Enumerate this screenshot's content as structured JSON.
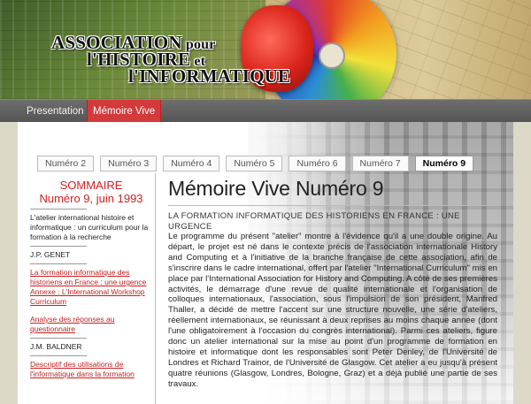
{
  "banner": {
    "line1": "ASSOCIATION",
    "line1_small": " pour",
    "line2": "l'HISTOIRE",
    "line2_small": " et",
    "line3": "l'INFORMATIQUE"
  },
  "nav": {
    "tabs": [
      {
        "label": "Presentation"
      },
      {
        "label": "Mémoire Vive"
      }
    ]
  },
  "issues": [
    {
      "label": "Numéro 2"
    },
    {
      "label": "Numéro 3"
    },
    {
      "label": "Numéro 4"
    },
    {
      "label": "Numéro 5"
    },
    {
      "label": "Numéro 6"
    },
    {
      "label": "Numéro 7"
    },
    {
      "label": "Numéro 9"
    }
  ],
  "sidebar": {
    "heading_line1": "SOMMAIRE",
    "heading_line2": "Numéro 9, juin 1993",
    "intro": "L'atelier international histoire et informatique : un curriculum pour la formation à la recherche",
    "author1": "J.P. GENET",
    "link1": "La formation informatique des historiens en France : une urgence",
    "link2": "Annexe : L'International Workshop Curriculum",
    "link3": "Analyse des réponses au questionnaire",
    "author2": "J.M. BALDNER",
    "link4": "Descriptif des utilisations de l'informatique dans la formation"
  },
  "main": {
    "title": "Mémoire Vive Numéro 9",
    "subtitle": "LA FORMATION INFORMATIQUE DES HISTORIENS EN FRANCE : UNE URGENCE",
    "body": "Le programme du présent \"atelier\" montre à l'évidence qu'il a une double origine. Au départ, le projet est né dans le contexte précis de l'association internationale History and Computing et à l'initiative de la branche française de cette association, afin de s'inscrire dans le cadre international, offert par l'atelier \"International Curriculum\" mis en place par l'International Association for History and Computing. A côté de ses premières activités, le démarrage d'une revue de qualité internationale et l'organisation de colloques internationaux, l'association, sous l'impulsion de son président, Manfred Thaller, a décidé de mettre l'accent sur une structure nouvelle, une série d'ateliers, réellement internationaux, se réunissant à deux reprises au moins chaque année (dont l'une obligatoirement à l'occasion du congrès international). Parmi ces ateliers, figure donc un atelier international sur la mise au point d'un programme de formation en histoire et informatique dont les responsables sont Peter Denley, de l'Université de Londres et Richard Trainor, de l'Université de Glasgow. Cet atelier a eu jusqu'à présent quatre réunions (Glasgow, Londres, Bologne, Graz) et a déjà publié une partie de ses travaux."
  }
}
